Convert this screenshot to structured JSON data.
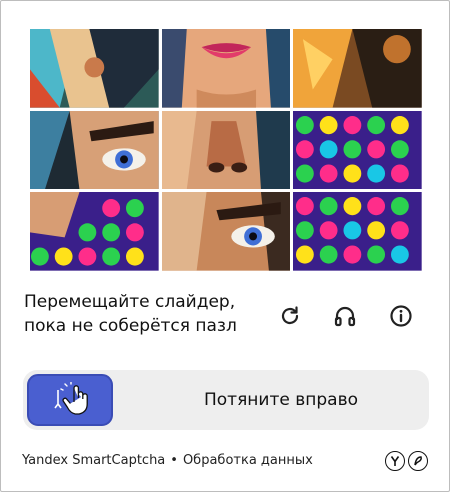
{
  "captcha": {
    "instruction_line1": "Перемещайте слайдер,",
    "instruction_line2": "пока не соберётся пазл",
    "slider_label": "Потяните вправо",
    "progress": 0
  },
  "icons": {
    "refresh": "refresh-icon",
    "audio": "headphones-icon",
    "info": "info-icon",
    "handle": "hand-pointer-icon"
  },
  "footer": {
    "brand_link": "Yandex SmartCaptcha",
    "separator": "•",
    "data_link": "Обработка данных"
  },
  "colors": {
    "handle": "#4a5fd0",
    "track": "#eeeeee",
    "dots": [
      "#2bd14f",
      "#ff2d8a",
      "#ffe11a",
      "#19c7e6",
      "#8a3dff"
    ]
  }
}
